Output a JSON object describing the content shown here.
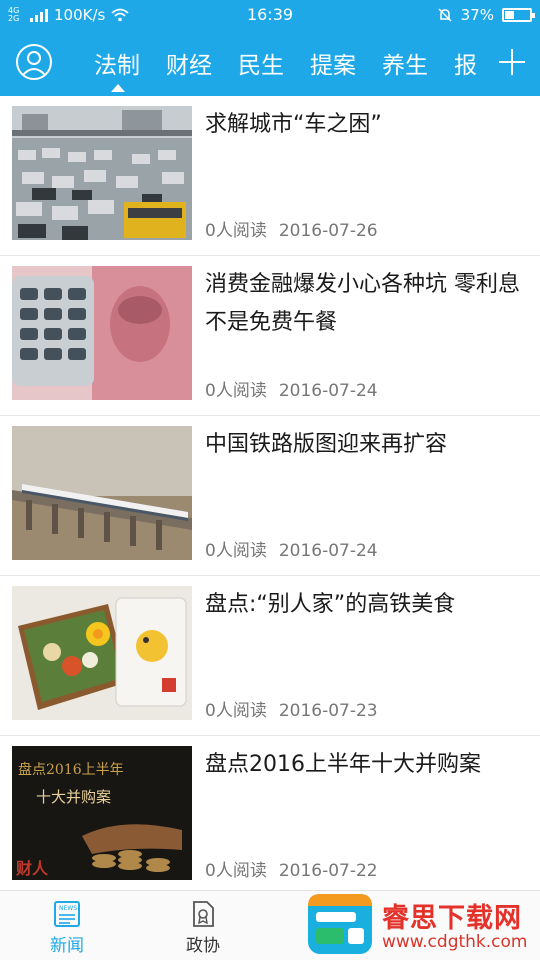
{
  "status_bar": {
    "network": "4G\n2G",
    "speed": "100K/s",
    "time": "16:39",
    "battery_text": "37%",
    "battery_level": 0.37
  },
  "top_nav": {
    "tabs": [
      "法制",
      "财经",
      "民生",
      "提案",
      "养生",
      "报"
    ],
    "active_tab": 0,
    "accent_color": "#1ea8e8"
  },
  "articles": [
    {
      "title": "求解城市“车之困”",
      "reads": "0人阅读",
      "date": "2016-07-26",
      "image": "traffic-jam-photo"
    },
    {
      "title": "消费金融爆发小心各种坑 零利息不是免费午餐",
      "reads": "0人阅读",
      "date": "2016-07-24",
      "image": "calculator-banknote-photo"
    },
    {
      "title": "中国铁路版图迎来再扩容",
      "reads": "0人阅读",
      "date": "2016-07-24",
      "image": "high-speed-train-photo"
    },
    {
      "title": "盘点:“别人家”的高铁美食",
      "reads": "0人阅读",
      "date": "2016-07-23",
      "image": "bento-box-photo"
    },
    {
      "title": "盘点2016上半年十大并购案",
      "reads": "0人阅读",
      "date": "2016-07-22",
      "image": "coins-hand-photo",
      "image_caption_1": "盘点2016上半年",
      "image_caption_2": "十大并购案",
      "image_logo": "财人"
    }
  ],
  "bottom_nav": {
    "items": [
      {
        "label": "新闻",
        "icon": "newspaper-icon",
        "active": true
      },
      {
        "label": "政协",
        "icon": "document-badge-icon",
        "active": false
      }
    ]
  },
  "watermark": {
    "text": "睿思下载网",
    "url": "www.cdgthk.com"
  }
}
